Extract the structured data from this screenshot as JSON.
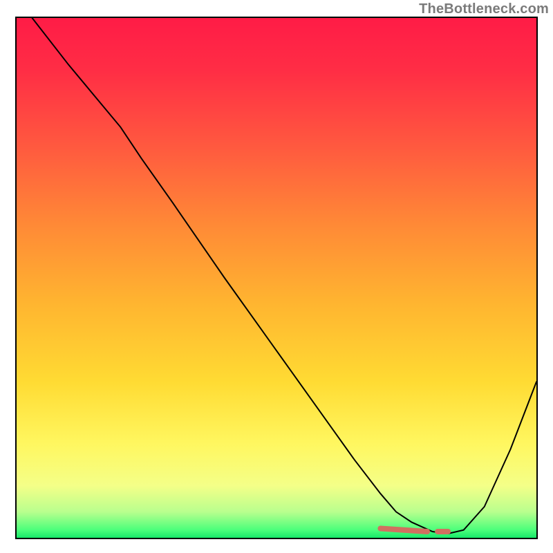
{
  "attribution": "TheBottleneck.com",
  "chart_data": {
    "type": "line",
    "title": "",
    "xlabel": "",
    "ylabel": "",
    "xlim": [
      0,
      100
    ],
    "ylim": [
      0,
      100
    ],
    "grid": false,
    "legend": false,
    "series": [
      {
        "name": "curve",
        "x": [
          3,
          10,
          20,
          24,
          30,
          40,
          50,
          60,
          65,
          70,
          73,
          76,
          80,
          83,
          86,
          90,
          95,
          100
        ],
        "y": [
          100,
          91,
          79,
          73,
          64.5,
          50,
          36,
          22,
          15,
          8.5,
          5,
          3,
          1.2,
          0.8,
          1.5,
          6,
          17,
          30
        ]
      }
    ],
    "markers": [
      {
        "name": "min-band-left",
        "x": [
          70,
          79
        ],
        "y": [
          1.8,
          1.2
        ]
      },
      {
        "name": "min-point-right",
        "x": [
          81,
          83
        ],
        "y": [
          1.2,
          1.2
        ]
      }
    ],
    "background_gradient": {
      "stops": [
        {
          "offset": 0.0,
          "color": "#ff1c46"
        },
        {
          "offset": 0.1,
          "color": "#ff2d45"
        },
        {
          "offset": 0.25,
          "color": "#ff5a3f"
        },
        {
          "offset": 0.4,
          "color": "#ff8a36"
        },
        {
          "offset": 0.55,
          "color": "#ffb530"
        },
        {
          "offset": 0.7,
          "color": "#ffdb33"
        },
        {
          "offset": 0.82,
          "color": "#fff760"
        },
        {
          "offset": 0.9,
          "color": "#f4ff88"
        },
        {
          "offset": 0.95,
          "color": "#b9ff8e"
        },
        {
          "offset": 0.985,
          "color": "#4bff7b"
        },
        {
          "offset": 1.0,
          "color": "#17e86a"
        }
      ]
    }
  }
}
